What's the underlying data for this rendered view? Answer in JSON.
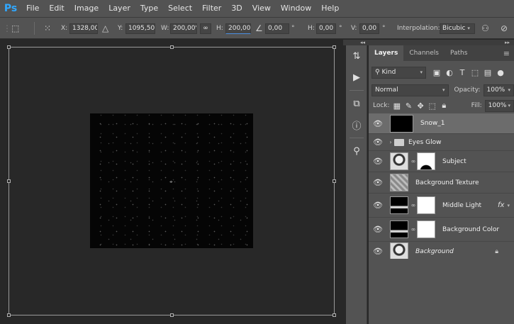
{
  "app": {
    "logo": "Ps"
  },
  "menu": [
    "File",
    "Edit",
    "Image",
    "Layer",
    "Type",
    "Select",
    "Filter",
    "3D",
    "View",
    "Window",
    "Help"
  ],
  "options": {
    "x_label": "X:",
    "x_value": "1328,00 p:",
    "y_label": "Y:",
    "y_value": "1095,50 p:",
    "w_label": "W:",
    "w_value": "200,00%",
    "h_label": "H:",
    "h_value": "200,00%",
    "angle_value": "0,00",
    "angle_unit": "°",
    "hskew_label": "H:",
    "hskew_value": "0,00",
    "hskew_unit": "°",
    "vskew_label": "V:",
    "vskew_value": "0,00",
    "vskew_unit": "°",
    "interp_label": "Interpolation:",
    "interp_value": "Bicubic"
  },
  "icons": {
    "ref_point": "⌖",
    "collapse": "◂◂",
    "expand": "▸▸"
  },
  "panel": {
    "tabs": [
      "Layers",
      "Channels",
      "Paths"
    ],
    "kind_label": "Kind",
    "blend_mode": "Normal",
    "opacity_label": "Opacity:",
    "opacity_value": "100%",
    "lock_label": "Lock:",
    "fill_label": "Fill:",
    "fill_value": "100%"
  },
  "layers": [
    {
      "name": "Snow_1",
      "selected": true
    },
    {
      "name": "Eyes Glow",
      "type": "group"
    },
    {
      "name": "Subject"
    },
    {
      "name": "Background Texture"
    },
    {
      "name": "Middle Light",
      "fx": "fx"
    },
    {
      "name": "Background Color"
    },
    {
      "name": "Background",
      "locked": true
    }
  ]
}
